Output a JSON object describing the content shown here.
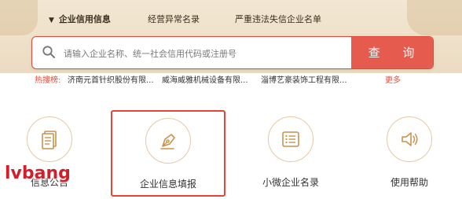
{
  "tabs": [
    {
      "label": "企业信用信息",
      "active": true
    },
    {
      "label": "经营异常名录",
      "active": false
    },
    {
      "label": "严重违法失信企业名单",
      "active": false
    }
  ],
  "search": {
    "placeholder": "请输入企业名称、统一社会信用代码或注册号",
    "button_label": "查 询"
  },
  "hot_search": {
    "label": "热搜榜:",
    "items": [
      "济南元首针织股份有限...",
      "威海威雅机械设备有限...",
      "淄博艺豪装饰工程有限..."
    ],
    "more_label": "更多"
  },
  "tiles": [
    {
      "label": "信息公告",
      "icon": "document-icon",
      "selected": false
    },
    {
      "label": "企业信息填报",
      "icon": "pen-nib-icon",
      "selected": true
    },
    {
      "label": "小微企业名录",
      "icon": "list-icon",
      "selected": false
    },
    {
      "label": "使用帮助",
      "icon": "speaker-icon",
      "selected": false
    }
  ],
  "watermark": "lvbang",
  "colors": {
    "accent_red": "#e55b4e",
    "highlight_border": "#e64535",
    "banner_bg": "#f0e3cc",
    "icon_gold": "#c9924f"
  }
}
